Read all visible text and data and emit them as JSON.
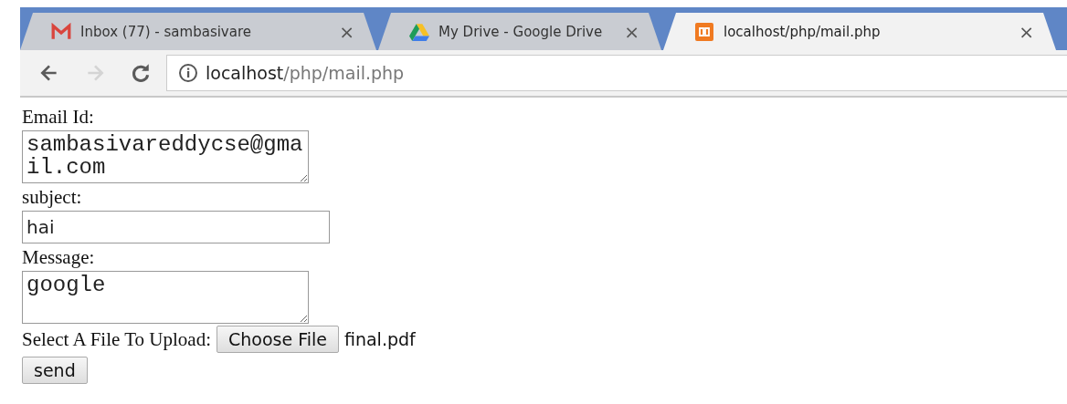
{
  "tabs": [
    {
      "title": "Inbox (77) - sambasivare",
      "close": "×",
      "selected": false
    },
    {
      "title": "My Drive - Google Drive",
      "close": "×",
      "selected": false
    },
    {
      "title": "localhost/php/mail.php",
      "close": "×",
      "selected": true
    }
  ],
  "toolbar": {
    "nav": [
      {
        "kind": "back",
        "disabled": false
      },
      {
        "kind": "forward",
        "disabled": true
      },
      {
        "kind": "reload",
        "disabled": false
      }
    ],
    "address": {
      "host": "localhost",
      "path": "/php/mail.php"
    }
  },
  "form": {
    "fields": [
      {
        "label": "Email Id:",
        "kind": "textarea",
        "value": "sambasivareddycse@gmail.com"
      },
      {
        "label": "subject:",
        "kind": "input",
        "value": "hai"
      },
      {
        "label": "Message:",
        "kind": "textarea",
        "value": "google"
      }
    ],
    "file": {
      "label": "Select A File To Upload:",
      "button": "Choose File",
      "filename": "final.pdf"
    },
    "submit": "send"
  }
}
